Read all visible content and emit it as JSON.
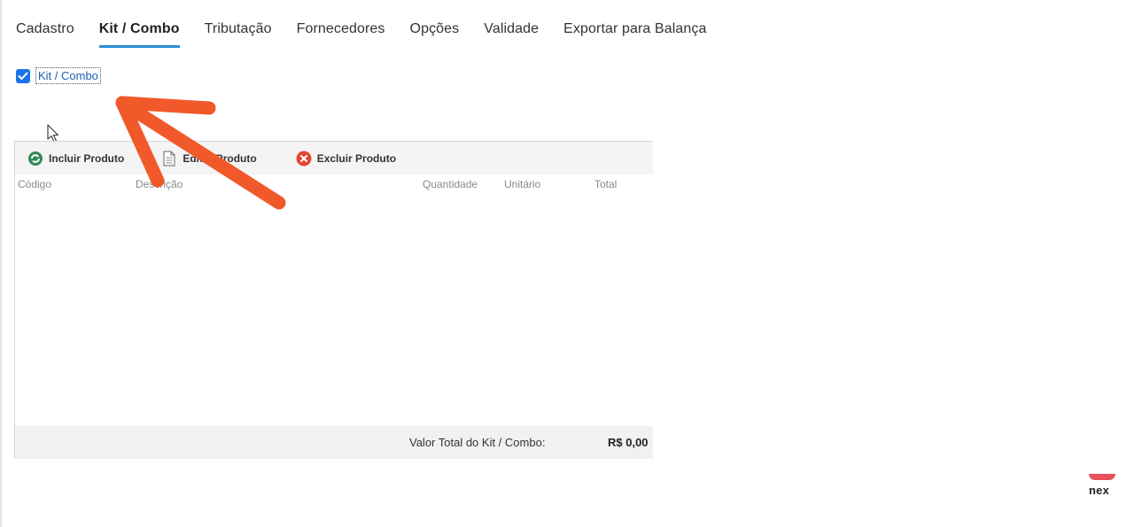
{
  "tabs": [
    {
      "label": "Cadastro",
      "active": false
    },
    {
      "label": "Kit / Combo",
      "active": true
    },
    {
      "label": "Tributação",
      "active": false
    },
    {
      "label": "Fornecedores",
      "active": false
    },
    {
      "label": "Opções",
      "active": false
    },
    {
      "label": "Validade",
      "active": false
    },
    {
      "label": "Exportar para Balança",
      "active": false
    }
  ],
  "kit_checkbox": {
    "label": "Kit / Combo",
    "checked": true
  },
  "toolbar": {
    "add_label": "Incluir Produto",
    "edit_label": "Editar Produto",
    "delete_label": "Excluir Produto"
  },
  "table": {
    "columns": [
      "Código",
      "Descrição",
      "Quantidade",
      "Unitário",
      "Total"
    ],
    "rows": []
  },
  "footer": {
    "total_label": "Valor Total do Kit / Combo:",
    "total_value": "R$ 0,00"
  },
  "logo": {
    "text": "nex"
  },
  "colors": {
    "accent": "#2b8fd1",
    "checkbox": "#1a73e8",
    "arrow": "#f1592a",
    "logo": "#e8505b"
  }
}
